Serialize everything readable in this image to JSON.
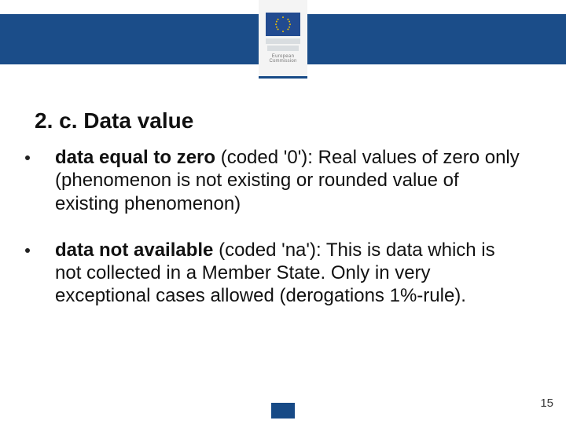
{
  "logo": {
    "label_line1": "European",
    "label_line2": "Commission"
  },
  "title": "2. c.  Data value",
  "bullets": [
    {
      "bold": "data equal to zero",
      "rest": " (coded '0'): Real values of zero only (phenomenon is not existing or rounded value of existing phenomenon)"
    },
    {
      "bold": "data not available",
      "rest": " (coded 'na'): This is data which is not collected in a Member State. Only in very exceptional cases allowed (derogations 1%-rule)."
    }
  ],
  "page_number": "15"
}
